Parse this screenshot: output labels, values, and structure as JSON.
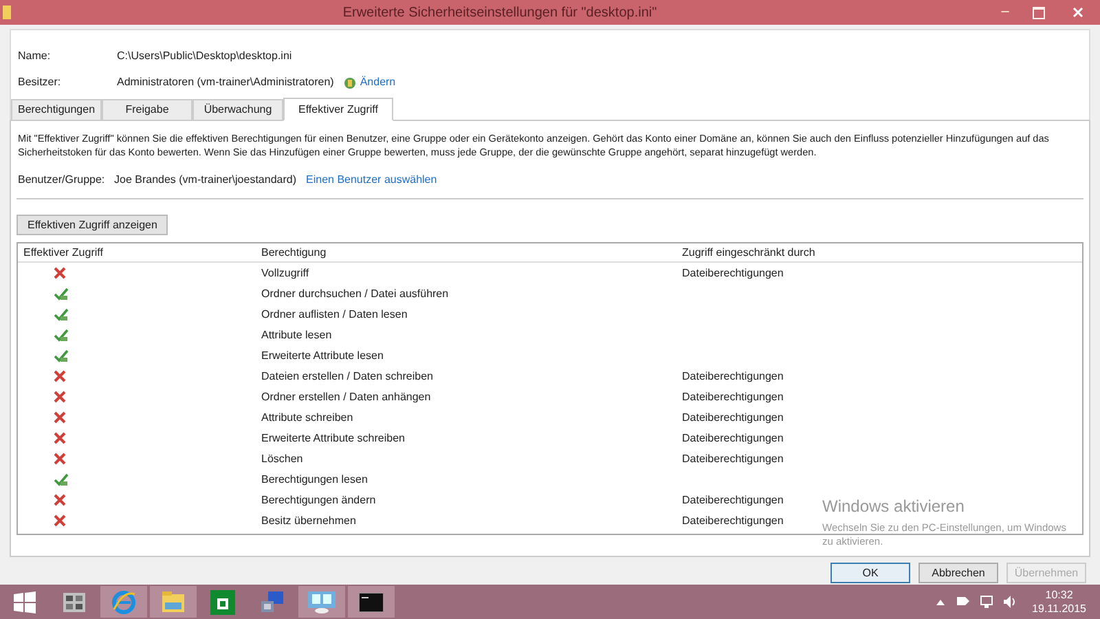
{
  "window": {
    "title": "Erweiterte Sicherheitseinstellungen für \"desktop.ini\"",
    "minimize": "–"
  },
  "info": [
    {
      "label": "Name:",
      "value": "C:\\Users\\Public\\Desktop\\desktop.ini"
    },
    {
      "label": "Besitzer:",
      "value": "Administratoren (vm-trainer\\Administratoren)",
      "link": "Ändern"
    }
  ],
  "tabs": [
    {
      "label": "Berechtigungen",
      "selected": false
    },
    {
      "label": "Freigabe",
      "selected": false
    },
    {
      "label": "Überwachung",
      "selected": false
    },
    {
      "label": "Effektiver Zugriff",
      "selected": true
    }
  ],
  "description": "Mit \"Effektiver Zugriff\" können Sie die effektiven Berechtigungen für einen Benutzer, eine Gruppe oder ein Gerätekonto anzeigen. Gehört das Konto einer Domäne an, können Sie auch den Einfluss potenzieller Hinzufügungen auf das Sicherheitstoken für das Konto bewerten. Wenn Sie das Hinzufügen einer Gruppe bewerten, muss jede Gruppe, der die gewünschte Gruppe angehört, separat hinzugefügt werden.",
  "user": {
    "label": "Benutzer/Gruppe:",
    "value": "Joe Brandes (vm-trainer\\joestandard)",
    "link": "Einen Benutzer auswählen"
  },
  "show_button": "Effektiven Zugriff anzeigen",
  "table": {
    "columns": [
      "Effektiver Zugriff",
      "Berechtigung",
      "Zugriff eingeschränkt durch"
    ],
    "rows": [
      {
        "allowed": false,
        "permission": "Vollzugriff",
        "restricted_by": "Dateiberechtigungen"
      },
      {
        "allowed": true,
        "permission": "Ordner durchsuchen / Datei ausführen"
      },
      {
        "allowed": true,
        "permission": "Ordner auflisten / Daten lesen"
      },
      {
        "allowed": true,
        "permission": "Attribute lesen"
      },
      {
        "allowed": true,
        "permission": "Erweiterte Attribute lesen"
      },
      {
        "allowed": false,
        "permission": "Dateien erstellen / Daten schreiben",
        "restricted_by": "Dateiberechtigungen"
      },
      {
        "allowed": false,
        "permission": "Ordner erstellen / Daten anhängen",
        "restricted_by": "Dateiberechtigungen"
      },
      {
        "allowed": false,
        "permission": "Attribute schreiben",
        "restricted_by": "Dateiberechtigungen"
      },
      {
        "allowed": false,
        "permission": "Erweiterte Attribute schreiben",
        "restricted_by": "Dateiberechtigungen"
      },
      {
        "allowed": false,
        "permission": "Löschen",
        "restricted_by": "Dateiberechtigungen"
      },
      {
        "allowed": true,
        "permission": "Berechtigungen lesen"
      },
      {
        "allowed": false,
        "permission": "Berechtigungen ändern",
        "restricted_by": "Dateiberechtigungen"
      },
      {
        "allowed": false,
        "permission": "Besitz übernehmen",
        "restricted_by": "Dateiberechtigungen"
      }
    ]
  },
  "buttons": [
    {
      "label": "OK",
      "disabled": false
    },
    {
      "label": "Abbrechen",
      "disabled": false
    },
    {
      "label": "Übernehmen",
      "disabled": true
    }
  ],
  "activation": {
    "title": "Windows aktivieren",
    "text": "Wechseln Sie zu den PC-Einstellungen, um Windows zu aktivieren."
  },
  "taskbar": {
    "apps": [
      {
        "kind": "start",
        "active": false
      },
      {
        "kind": "apps",
        "active": false
      },
      {
        "kind": "browser",
        "active": true
      },
      {
        "kind": "explorer",
        "active": true
      },
      {
        "kind": "store",
        "active": false
      },
      {
        "kind": "network",
        "active": false
      },
      {
        "kind": "remote",
        "active": true
      },
      {
        "kind": "console",
        "active": true
      }
    ],
    "time": "10:32",
    "date": "19.11.2015"
  }
}
